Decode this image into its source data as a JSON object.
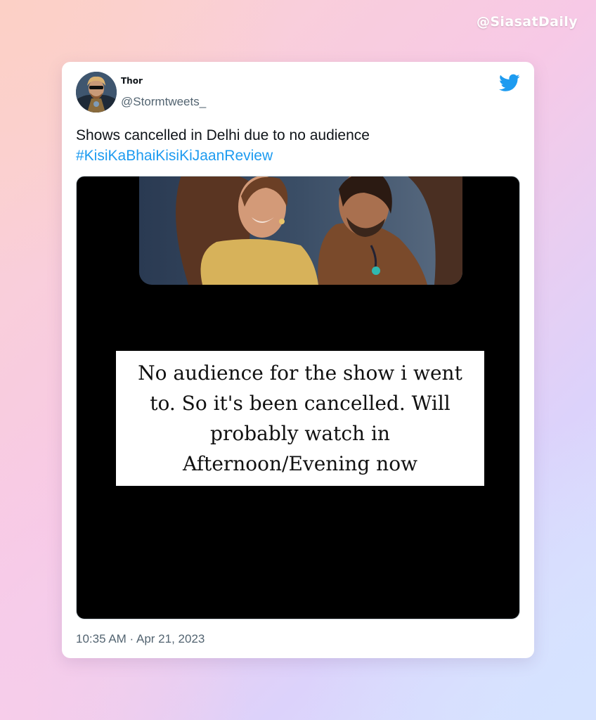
{
  "watermark": "@SiasatDaily",
  "tweet": {
    "display_name": "Thor",
    "handle": "@Stormtweets_",
    "text_line": "Shows cancelled in Delhi due to no audience",
    "hashtag": "#KisiKaBhaiKisiKiJaan​Review",
    "timestamp": "10:35 AM · Apr 21, 2023"
  },
  "media": {
    "caption": "No audience for the show i went to. So it's been cancelled. Will probably watch in Afternoon/Evening now"
  },
  "icons": {
    "logo": "twitter-bird-icon",
    "avatar": "thor-avatar-image"
  },
  "colors": {
    "link": "#1d9bf0",
    "text": "#0f1419",
    "secondary": "#536471",
    "media_bg": "#000000"
  }
}
